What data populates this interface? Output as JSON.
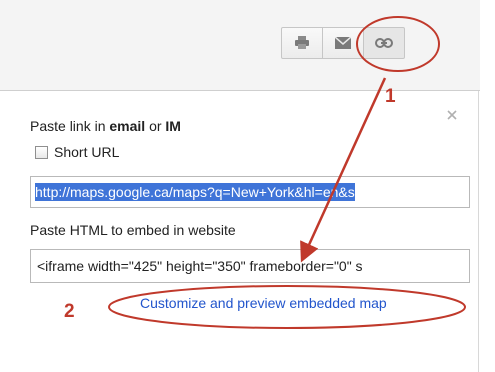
{
  "toolbar": {
    "buttons": [
      {
        "icon": "print-icon"
      },
      {
        "icon": "email-icon"
      },
      {
        "icon": "link-icon"
      }
    ]
  },
  "share_panel": {
    "paste_link_prefix": "Paste link in ",
    "paste_link_email": "email",
    "paste_link_or": " or ",
    "paste_link_im": "IM",
    "short_url_label": "Short URL",
    "short_url_checked": false,
    "link_value": "http://maps.google.ca/maps?q=New+York&hl=en&s",
    "embed_label": "Paste HTML to embed in website",
    "embed_value": "<iframe width=\"425\" height=\"350\" frameborder=\"0\" s",
    "customize_link": "Customize and preview embedded map"
  },
  "annotations": {
    "step_1": "1",
    "step_2": "2",
    "color": "#c0392b"
  }
}
